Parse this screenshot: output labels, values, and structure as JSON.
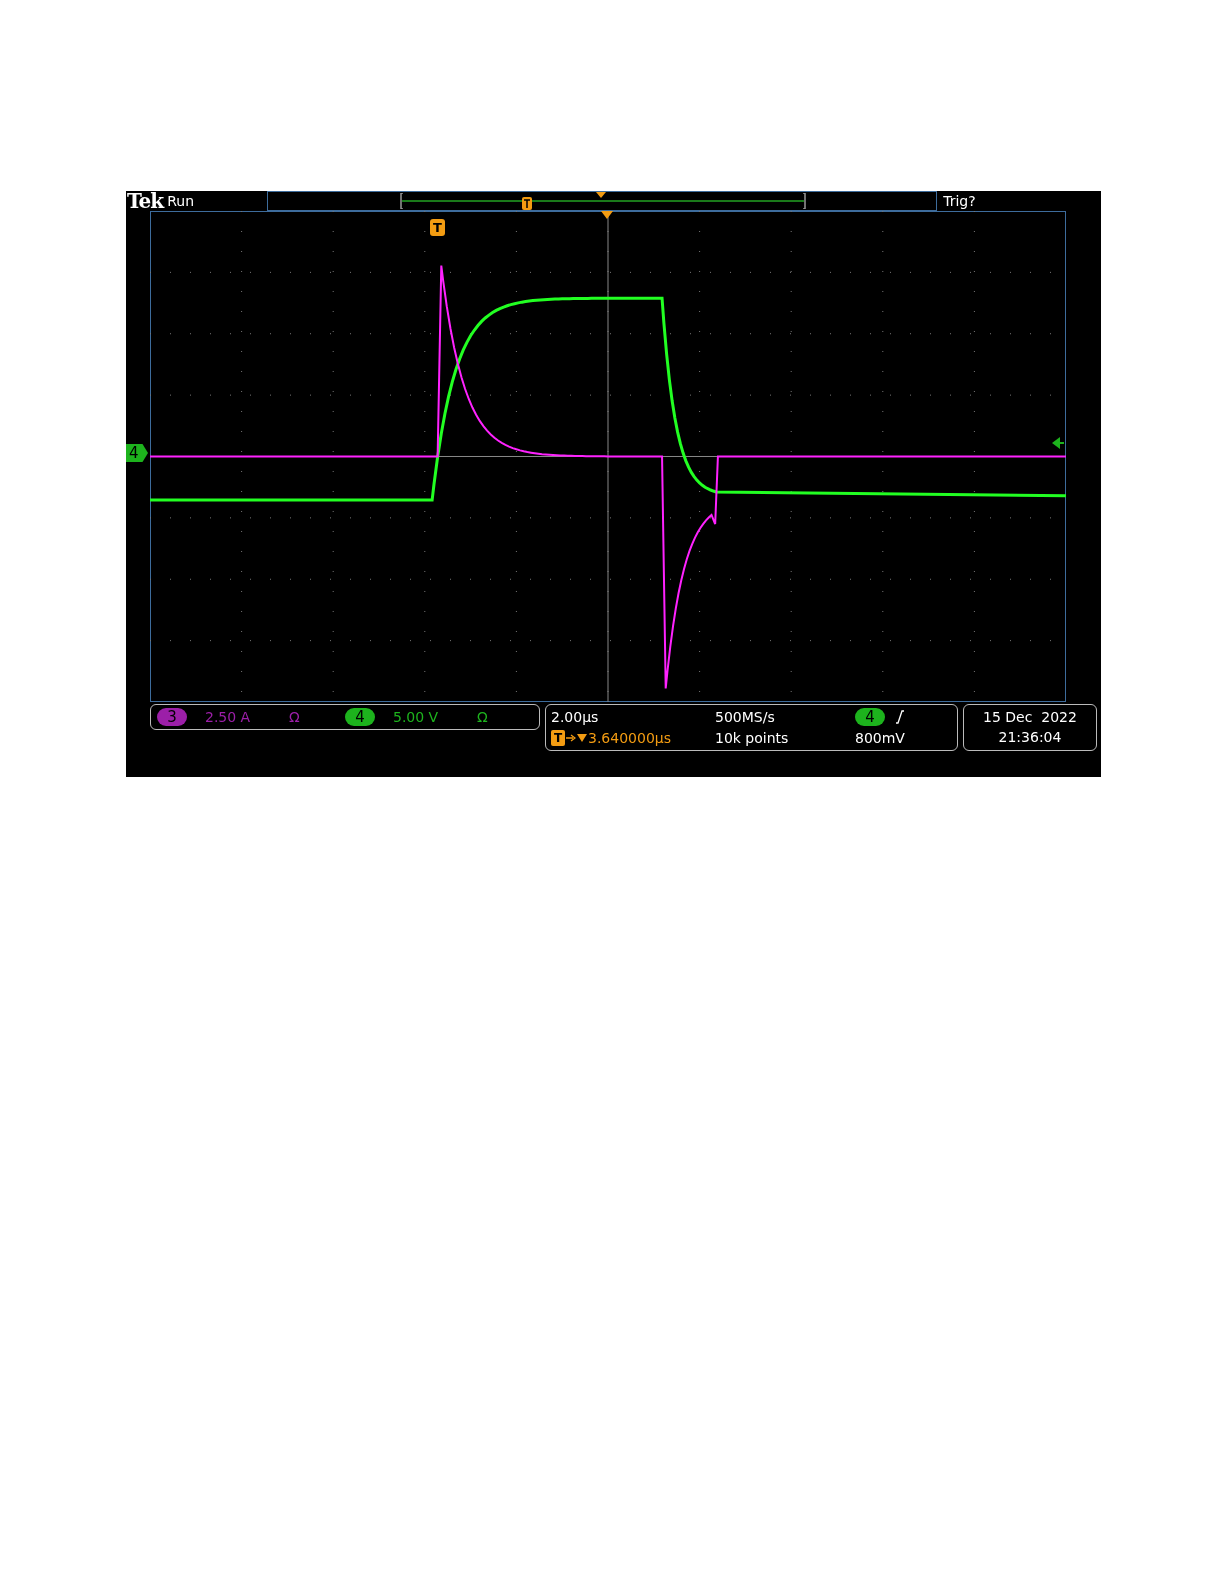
{
  "header": {
    "brand": "Tek",
    "status": "Run",
    "trigger_status": "Trig?"
  },
  "markers": {
    "trigger": "T",
    "channel_ground": "4"
  },
  "channels": [
    {
      "number": "3",
      "scale": "2.50 A",
      "coupling": "Ω",
      "color": "#9c1fa8"
    },
    {
      "number": "4",
      "scale": "5.00 V",
      "coupling": "Ω",
      "color": "#1db31d"
    }
  ],
  "timebase": {
    "scale": "2.00µs",
    "delay_marker": "T",
    "delay": "3.640000µs",
    "sample_rate": "500MS/s",
    "record_length": "10k points",
    "trigger_source": "4",
    "trigger_level": "800mV"
  },
  "datetime": {
    "date": "15 Dec  2022",
    "time": "21:36:04"
  }
}
